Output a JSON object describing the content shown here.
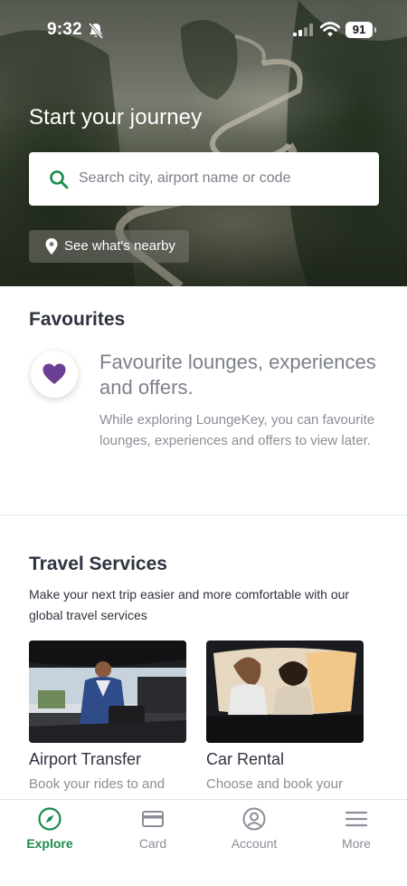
{
  "status_bar": {
    "time": "9:32",
    "battery": "91"
  },
  "hero": {
    "title": "Start your journey",
    "search": {
      "placeholder": "Search city, airport name or code"
    },
    "nearby_button": "See what's nearby"
  },
  "favourites": {
    "heading": "Favourites",
    "title": "Favourite lounges, experiences and offers.",
    "description": "While exploring LoungeKey, you can favourite lounges, experiences and offers to view later."
  },
  "travel_services": {
    "heading": "Travel Services",
    "description": "Make your next trip easier and more comfortable with our global travel services",
    "cards": [
      {
        "title": "Airport Transfer",
        "subtitle": "Book your rides to and"
      },
      {
        "title": "Car Rental",
        "subtitle": "Choose and book your"
      }
    ]
  },
  "tab_bar": {
    "tabs": [
      {
        "label": "Explore",
        "icon": "compass-icon",
        "active": true
      },
      {
        "label": "Card",
        "icon": "credit-card-icon",
        "active": false
      },
      {
        "label": "Account",
        "icon": "account-icon",
        "active": false
      },
      {
        "label": "More",
        "icon": "menu-icon",
        "active": false
      }
    ]
  },
  "colors": {
    "accent": "#1a8a4a",
    "heart": "#6b3f93"
  }
}
